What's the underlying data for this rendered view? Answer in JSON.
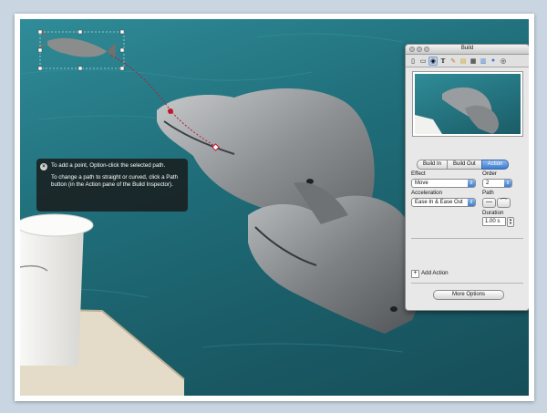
{
  "tooltip": {
    "line1": "To add a point, Option-click the selected path.",
    "line2": "To change a path to straight or curved, click a Path button (in the Action pane of the Build Inspector)."
  },
  "inspector": {
    "title": "Build",
    "toolbar_icons": [
      "document-icon",
      "slide-icon",
      "build-icon",
      "text-icon",
      "graphic-icon",
      "metrics-icon",
      "table-icon",
      "chart-icon",
      "hyperlink-icon",
      "quicktime-icon"
    ],
    "tabs": [
      "Build In",
      "Build Out",
      "Action"
    ],
    "selected_tab": "Action",
    "effect_label": "Effect",
    "effect_value": "Move",
    "order_label": "Order",
    "order_value": "2",
    "acceleration_label": "Acceleration",
    "acceleration_value": "Ease In & Ease Out",
    "path_label": "Path",
    "duration_label": "Duration",
    "duration_value": "1.00 s",
    "add_action_label": "Add Action",
    "more_options_label": "More Options"
  },
  "colors": {
    "accent": "#3b7cd2",
    "path_red": "#c0182a"
  }
}
